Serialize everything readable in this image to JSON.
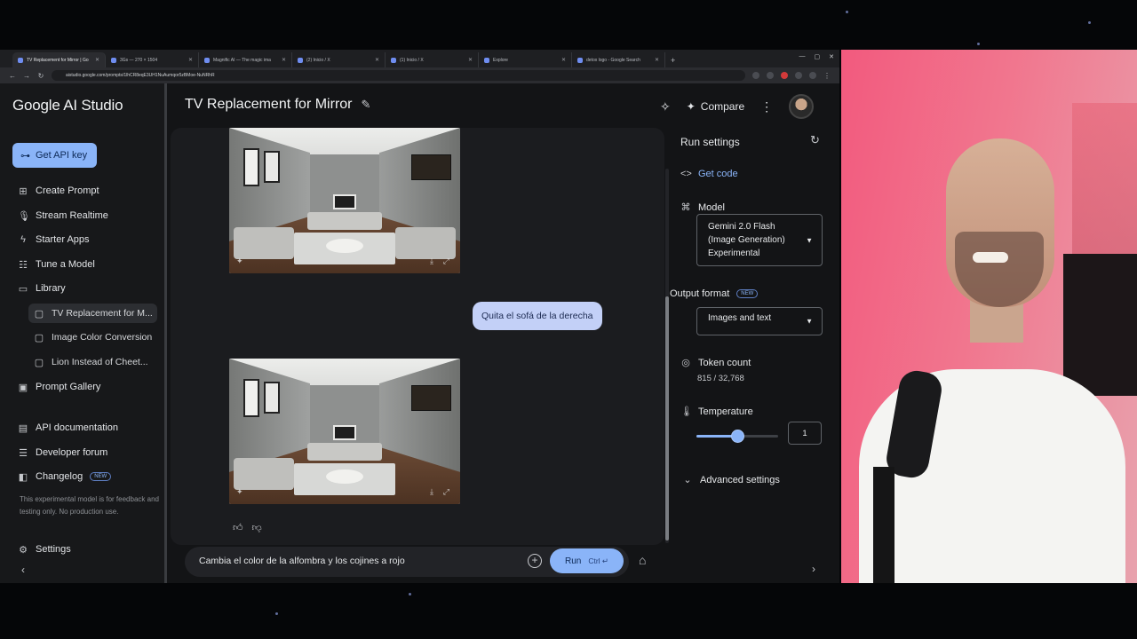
{
  "browser": {
    "tabs": [
      {
        "label": "TV Replacement for Mirror | Go",
        "active": true
      },
      {
        "label": "3Gs — 270 × 1504",
        "active": false
      },
      {
        "label": "Magnific AI — The magic ima",
        "active": false
      },
      {
        "label": "(2) Inicio / X",
        "active": false
      },
      {
        "label": "(1) Inicio / X",
        "active": false
      },
      {
        "label": "Explore",
        "active": false
      },
      {
        "label": "detox logo - Google Search",
        "active": false
      }
    ],
    "url": "aistudio.google.com/prompts/1lhCR8eqE3UH1NuAumqor5zBMoe-NuNRhR"
  },
  "sidebar": {
    "brand": "Google AI Studio",
    "api_key_label": "Get API key",
    "items": [
      {
        "label": "Create Prompt",
        "icon": "create-icon"
      },
      {
        "label": "Stream Realtime",
        "icon": "mic-icon"
      },
      {
        "label": "Starter Apps",
        "icon": "bolt-icon"
      },
      {
        "label": "Tune a Model",
        "icon": "tune-icon"
      },
      {
        "label": "Library",
        "icon": "library-icon"
      },
      {
        "label": "TV Replacement for M...",
        "icon": "chat-icon"
      },
      {
        "label": "Image Color Conversion",
        "icon": "chat-icon"
      },
      {
        "label": "Lion Instead of Cheet...",
        "icon": "chat-icon"
      },
      {
        "label": "Prompt Gallery",
        "icon": "gallery-icon"
      },
      {
        "label": "API documentation",
        "icon": "doc-icon"
      },
      {
        "label": "Developer forum",
        "icon": "forum-icon"
      },
      {
        "label": "Changelog",
        "icon": "changelog-icon"
      }
    ],
    "new_badge": "NEW",
    "disclaimer": "This experimental model is for feedback and testing only. No production use.",
    "settings_label": "Settings"
  },
  "header": {
    "title": "TV Replacement for Mirror",
    "compare_label": "Compare"
  },
  "chat": {
    "user_message": "Quita el sofá de la derecha",
    "prompt_value": "Cambia el color de la alfombra y los cojines a rojo",
    "run_label": "Run",
    "run_hint": "Ctrl ↵"
  },
  "run_settings": {
    "title": "Run settings",
    "get_code": "Get code",
    "model_label": "Model",
    "model_value_line1": "Gemini 2.0 Flash",
    "model_value_line2": "(Image Generation)",
    "model_value_line3": "Experimental",
    "output_format_label": "Output format",
    "output_format_badge": "NEW",
    "output_format_value": "Images and text",
    "token_count_label": "Token count",
    "token_count_value": "815 / 32,768",
    "temperature_label": "Temperature",
    "temperature_value": "1",
    "temperature_level": 0.5,
    "advanced_label": "Advanced settings"
  },
  "colors": {
    "accent": "#8ab4f8",
    "background": "#131416",
    "webcam_wall": "#f25a7e"
  }
}
